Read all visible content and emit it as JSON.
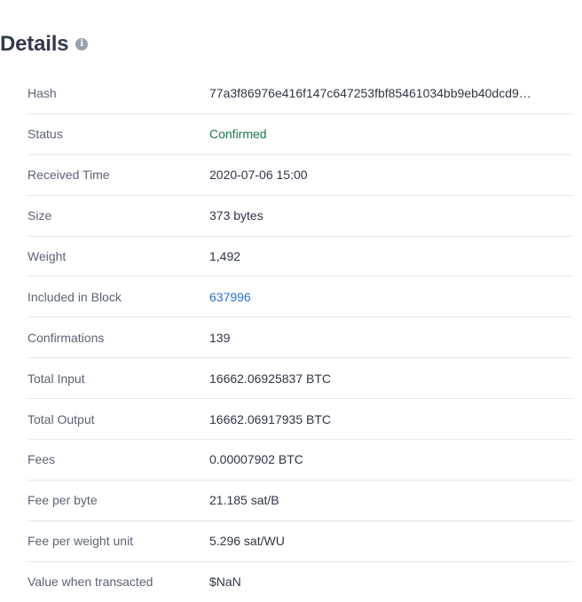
{
  "header": {
    "title": "Details",
    "info_icon": "info-icon"
  },
  "colors": {
    "title": "#333a4d",
    "label": "#5b6375",
    "value": "#2f3647",
    "confirmed": "#157a4a",
    "link": "#2d6fd6",
    "divider": "#e6e8ee"
  },
  "details": {
    "hash": {
      "label": "Hash",
      "value": "77a3f86976e416f147c647253fbf85461034bb9eb40dcd9…"
    },
    "status": {
      "label": "Status",
      "value": "Confirmed"
    },
    "received_time": {
      "label": "Received Time",
      "value": "2020-07-06 15:00"
    },
    "size": {
      "label": "Size",
      "value": "373 bytes"
    },
    "weight": {
      "label": "Weight",
      "value": "1,492"
    },
    "included_in_block": {
      "label": "Included in Block",
      "value": "637996"
    },
    "confirmations": {
      "label": "Confirmations",
      "value": "139"
    },
    "total_input": {
      "label": "Total Input",
      "value": "16662.06925837 BTC"
    },
    "total_output": {
      "label": "Total Output",
      "value": "16662.06917935 BTC"
    },
    "fees": {
      "label": "Fees",
      "value": "0.00007902 BTC"
    },
    "fee_per_byte": {
      "label": "Fee per byte",
      "value": "21.185 sat/B"
    },
    "fee_per_weight_unit": {
      "label": "Fee per weight unit",
      "value": "5.296 sat/WU"
    },
    "value_when_transacted": {
      "label": "Value when transacted",
      "value": "$NaN"
    }
  }
}
